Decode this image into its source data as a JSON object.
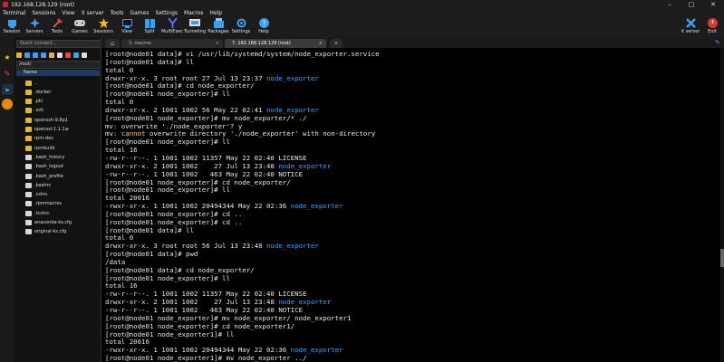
{
  "window": {
    "title": "192.168.128.129 (root)",
    "controls": [
      "–",
      "□",
      "✕"
    ]
  },
  "menu": [
    "Terminal",
    "Sessions",
    "View",
    "X server",
    "Tools",
    "Games",
    "Settings",
    "Macros",
    "Help"
  ],
  "toolbar": [
    {
      "label": "Session",
      "icon": "session-icon",
      "color": "#3aa0f0"
    },
    {
      "label": "Servers",
      "icon": "servers-icon",
      "color": "#3aa0f0"
    },
    {
      "label": "Tools",
      "icon": "tools-icon",
      "color": "#e84b3c"
    },
    {
      "label": "Games",
      "icon": "games-icon",
      "color": "#cfcfcf"
    },
    {
      "label": "Sessions",
      "icon": "sessions-star-icon",
      "color": "#f0c000"
    },
    {
      "label": "View",
      "icon": "view-icon",
      "color": "#3aa0f0"
    },
    {
      "label": "Split",
      "icon": "split-icon",
      "color": "#3aa0f0"
    },
    {
      "label": "MultiExec",
      "icon": "multiexec-icon",
      "color": "#5b6cff"
    },
    {
      "label": "Tunneling",
      "icon": "tunneling-icon",
      "color": "#dddddd"
    },
    {
      "label": "Packages",
      "icon": "packages-icon",
      "color": "#3aa0f0"
    },
    {
      "label": "Settings",
      "icon": "settings-icon",
      "color": "#3aa0f0"
    },
    {
      "label": "Help",
      "icon": "help-icon",
      "color": "#3aa0f0"
    }
  ],
  "toolbar_right": [
    {
      "label": "X server",
      "icon": "xserver-icon",
      "color": "#3aa0f0"
    },
    {
      "label": "Exit",
      "icon": "exit-icon",
      "color": "#e83030"
    }
  ],
  "sidebar": {
    "quick_connect": "Quick connect...",
    "path": "/root/",
    "header": "Name",
    "files": [
      {
        "name": "..",
        "type": "folder"
      },
      {
        "name": ".docker",
        "type": "folder"
      },
      {
        "name": ".pki",
        "type": "folder"
      },
      {
        "name": ".ssh",
        "type": "folder"
      },
      {
        "name": "openssh-9.8p1",
        "type": "folder"
      },
      {
        "name": "openssl-1.1.1w",
        "type": "folder"
      },
      {
        "name": "rpm-dev",
        "type": "folder"
      },
      {
        "name": "rpmbuild",
        "type": "folder"
      },
      {
        "name": ".bash_history",
        "type": "file"
      },
      {
        "name": ".bash_logout",
        "type": "file"
      },
      {
        "name": ".bash_profile",
        "type": "file"
      },
      {
        "name": ".bashrc",
        "type": "file"
      },
      {
        "name": ".cshrc",
        "type": "file"
      },
      {
        "name": ".rpmmacros",
        "type": "file"
      },
      {
        "name": ".tcshrc",
        "type": "file"
      },
      {
        "name": "anaconda-ks.cfg",
        "type": "file"
      },
      {
        "name": "original-ks.cfg",
        "type": "file"
      }
    ]
  },
  "tabs": [
    {
      "label": "3. mecme"
    },
    {
      "label": "7. 192.168.128.129 (root)"
    }
  ],
  "terminal": [
    [
      {
        "t": "[root@node01 data]# vi /usr/lib/systemd/system/node_exporter.service"
      }
    ],
    [
      {
        "t": "[root@node01 data]# ll"
      }
    ],
    [
      {
        "t": "total 0"
      }
    ],
    [
      {
        "t": "drwxr-xr-x. 3 root root 27 Jul 13 23:37 "
      },
      {
        "t": "node_exporter",
        "c": "dir"
      }
    ],
    [
      {
        "t": "[root@node01 data]# cd node_exporter/"
      }
    ],
    [
      {
        "t": "[root@node01 node_exporter]# ll"
      }
    ],
    [
      {
        "t": "total 0"
      }
    ],
    [
      {
        "t": "drwxr-xr-x. 2 1001 1002 56 May 22 02:41 "
      },
      {
        "t": "node_exporter",
        "c": "dir"
      }
    ],
    [
      {
        "t": "[root@node01 node_exporter]# mv node_exporter/* ./"
      }
    ],
    [
      {
        "t": "mv: overwrite './node_exporter'? y"
      }
    ],
    [
      {
        "t": "mv: "
      },
      {
        "t": "cannot",
        "c": "warn"
      },
      {
        "t": " overwrite directory './node_exporter' with non-directory"
      }
    ],
    [
      {
        "t": "[root@node01 node_exporter]# ll"
      }
    ],
    [
      {
        "t": "total 16"
      }
    ],
    [
      {
        "t": "-rw-r--r--. 1 1001 1002 11357 May 22 02:40 LICENSE"
      }
    ],
    [
      {
        "t": "drwxr-xr-x. 2 1001 1002    27 Jul 13 23:48 "
      },
      {
        "t": "node_exporter",
        "c": "dir"
      }
    ],
    [
      {
        "t": "-rw-r--r--. 1 1001 1002   463 May 22 02:40 NOTICE"
      }
    ],
    [
      {
        "t": "[root@node01 node_exporter]# cd node_exporter/"
      }
    ],
    [
      {
        "t": "[root@node01 node_exporter]# ll"
      }
    ],
    [
      {
        "t": "total 20016"
      }
    ],
    [
      {
        "t": "-rwxr-xr-x. 1 1001 1002 20494344 May 22 02:36 "
      },
      {
        "t": "node_exporter",
        "c": "dir"
      }
    ],
    [
      {
        "t": "[root@node01 node_exporter]# cd .."
      }
    ],
    [
      {
        "t": "[root@node01 node_exporter]# cd .."
      }
    ],
    [
      {
        "t": "[root@node01 data]# ll"
      }
    ],
    [
      {
        "t": "total 0"
      }
    ],
    [
      {
        "t": "drwxr-xr-x. 3 root root 56 Jul 13 23:48 "
      },
      {
        "t": "node_exporter",
        "c": "dir"
      }
    ],
    [
      {
        "t": "[root@node01 data]# pwd"
      }
    ],
    [
      {
        "t": "/data"
      }
    ],
    [
      {
        "t": "[root@node01 data]# cd node_exporter/"
      }
    ],
    [
      {
        "t": "[root@node01 node_exporter]# ll"
      }
    ],
    [
      {
        "t": "total 16"
      }
    ],
    [
      {
        "t": "-rw-r--r--. 1 1001 1002 11357 May 22 02:40 LICENSE"
      }
    ],
    [
      {
        "t": "drwxr-xr-x. 2 1001 1002    27 Jul 13 23:48 "
      },
      {
        "t": "node_exporter",
        "c": "dir"
      }
    ],
    [
      {
        "t": "-rw-r--r--. 1 1001 1002   463 May 22 02:40 NOTICE"
      }
    ],
    [
      {
        "t": "[root@node01 node_exporter]# mv node_exporter/ node_exporter1"
      }
    ],
    [
      {
        "t": "[root@node01 node_exporter]# cd node_exporter1/"
      }
    ],
    [
      {
        "t": "[root@node01 node_exporter1]# ll"
      }
    ],
    [
      {
        "t": "total 20016"
      }
    ],
    [
      {
        "t": "-rwxr-xr-x. 1 1001 1002 20494344 May 22 02:36 "
      },
      {
        "t": "node_exporter",
        "c": "dir"
      }
    ],
    [
      {
        "t": "[root@node01 node_exporter1]# mv node_exporter ../"
      }
    ]
  ]
}
